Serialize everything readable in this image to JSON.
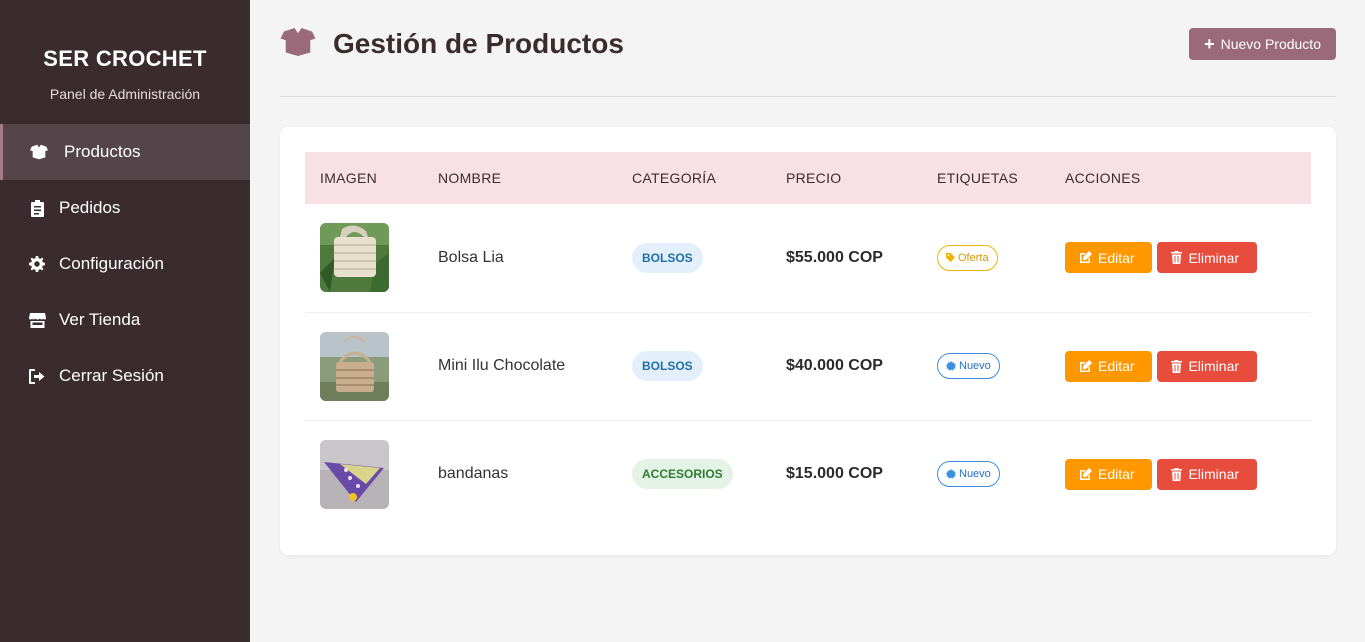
{
  "sidebar": {
    "brand_title": "SER CROCHET",
    "brand_subtitle": "Panel de Administración",
    "items": [
      {
        "label": "Productos",
        "icon": "box-open-icon",
        "active": true
      },
      {
        "label": "Pedidos",
        "icon": "clipboard-icon",
        "active": false
      },
      {
        "label": "Configuración",
        "icon": "gear-icon",
        "active": false
      },
      {
        "label": "Ver Tienda",
        "icon": "store-icon",
        "active": false
      },
      {
        "label": "Cerrar Sesión",
        "icon": "sign-out-icon",
        "active": false
      }
    ]
  },
  "header": {
    "title": "Gestión de Productos",
    "title_icon": "box-open-icon",
    "new_button_label": "Nuevo Producto"
  },
  "table": {
    "columns": [
      "IMAGEN",
      "NOMBRE",
      "CATEGORÍA",
      "PRECIO",
      "ETIQUETAS",
      "ACCIONES"
    ],
    "rows": [
      {
        "name": "Bolsa Lia",
        "category": "BOLSOS",
        "price": "$55.000 COP",
        "tag": "Oferta",
        "image": "crochet-bag-photo"
      },
      {
        "name": "Mini Ilu Chocolate",
        "category": "BOLSOS",
        "price": "$40.000 COP",
        "tag": "Nuevo",
        "image": "crochet-bag-photo"
      },
      {
        "name": "bandanas",
        "category": "ACCESORIOS",
        "price": "$15.000 COP",
        "tag": "Nuevo",
        "image": "bandana-photo"
      }
    ],
    "edit_label": "Editar",
    "delete_label": "Eliminar"
  },
  "colors": {
    "sidebar_bg": "#3a2b2e",
    "accent": "#9a6a7b",
    "table_header_bg": "#f8e1e5",
    "edit": "#ff9800",
    "delete": "#e74c3c"
  }
}
